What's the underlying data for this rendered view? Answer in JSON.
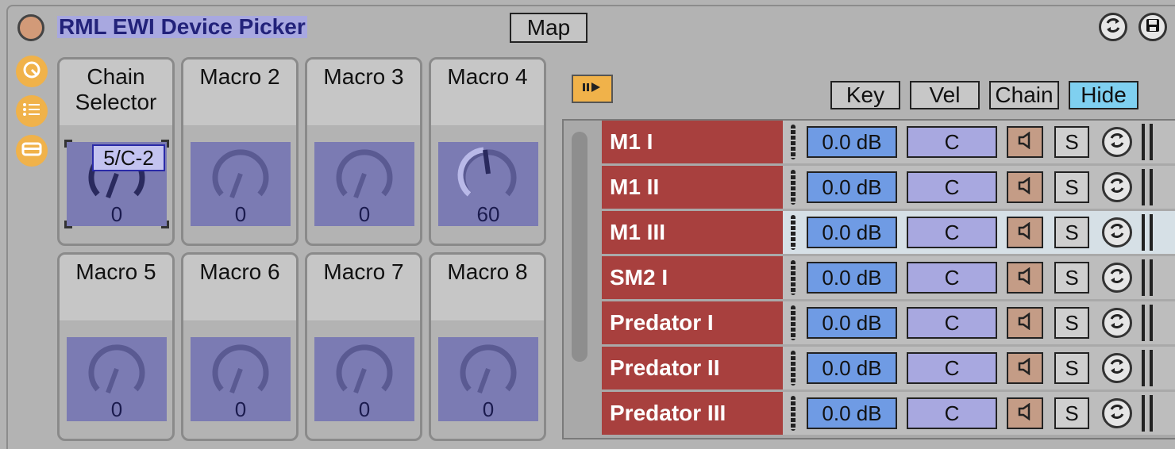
{
  "device": {
    "title": "RML EWI Device Picker",
    "map_label": "Map"
  },
  "side_icons": [
    "random-icon",
    "list-icon",
    "panel-icon"
  ],
  "macros": [
    {
      "name": "Chain Selector",
      "value": "0",
      "tooltip": "5/C-2"
    },
    {
      "name": "Macro 2",
      "value": "0"
    },
    {
      "name": "Macro 3",
      "value": "0"
    },
    {
      "name": "Macro 4",
      "value": "60"
    },
    {
      "name": "Macro 5",
      "value": "0"
    },
    {
      "name": "Macro 6",
      "value": "0"
    },
    {
      "name": "Macro 7",
      "value": "0"
    },
    {
      "name": "Macro 8",
      "value": "0"
    }
  ],
  "chain_toolbar": {
    "key_label": "Key",
    "vel_label": "Vel",
    "chain_label": "Chain",
    "hide_label": "Hide"
  },
  "chains": [
    {
      "name": "M1 I",
      "volume": "0.0 dB",
      "key": "C",
      "solo": "S"
    },
    {
      "name": "M1 II",
      "volume": "0.0 dB",
      "key": "C",
      "solo": "S"
    },
    {
      "name": "M1 III",
      "volume": "0.0 dB",
      "key": "C",
      "solo": "S"
    },
    {
      "name": "SM2 I",
      "volume": "0.0 dB",
      "key": "C",
      "solo": "S"
    },
    {
      "name": "Predator I",
      "volume": "0.0 dB",
      "key": "C",
      "solo": "S"
    },
    {
      "name": "Predator II",
      "volume": "0.0 dB",
      "key": "C",
      "solo": "S"
    },
    {
      "name": "Predator III",
      "volume": "0.0 dB",
      "key": "C",
      "solo": "S"
    }
  ],
  "colors": {
    "chain_red": "#a8403e",
    "volume_blue": "#6f9be4",
    "knob_bg": "#7b7bb3",
    "accent_orange": "#f0b24a",
    "hide_active": "#7fd0f0"
  }
}
